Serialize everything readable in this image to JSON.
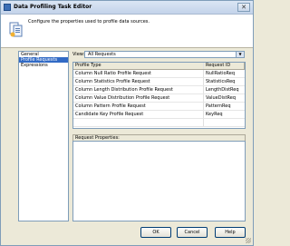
{
  "window": {
    "title": "Data Profiling Task Editor",
    "close_glyph": "✕"
  },
  "header": {
    "description": "Configure the properties used to profile data sources.",
    "icon": "data-profiling-task-icon"
  },
  "nav": {
    "items": [
      {
        "label": "General"
      },
      {
        "label": "Profile Requests",
        "selected": true
      },
      {
        "label": "Expressions"
      }
    ]
  },
  "view": {
    "label": "View:",
    "selected": "All Requests"
  },
  "grid": {
    "columns": [
      "Profile Type",
      "Request ID"
    ],
    "rows": [
      {
        "type": "Column Null Ratio Profile Request",
        "id": "NullRatioReq"
      },
      {
        "type": "Column Statistics Profile Request",
        "id": "StatisticsReq"
      },
      {
        "type": "Column Length Distribution Profile Request",
        "id": "LengthDistReq"
      },
      {
        "type": "Column Value Distribution Profile Request",
        "id": "ValueDistReq"
      },
      {
        "type": "Column Pattern Profile Request",
        "id": "PatternReq"
      },
      {
        "type": "Candidate Key Profile Request",
        "id": "KeyReq"
      },
      {
        "type": "",
        "id": ""
      }
    ]
  },
  "properties": {
    "label": "Request Properties:"
  },
  "buttons": {
    "ok": "OK",
    "cancel": "Cancel",
    "help": "Help"
  },
  "colors": {
    "selection": "#316ac5",
    "border": "#7f9db9",
    "dialog_bg": "#ece9d8"
  }
}
